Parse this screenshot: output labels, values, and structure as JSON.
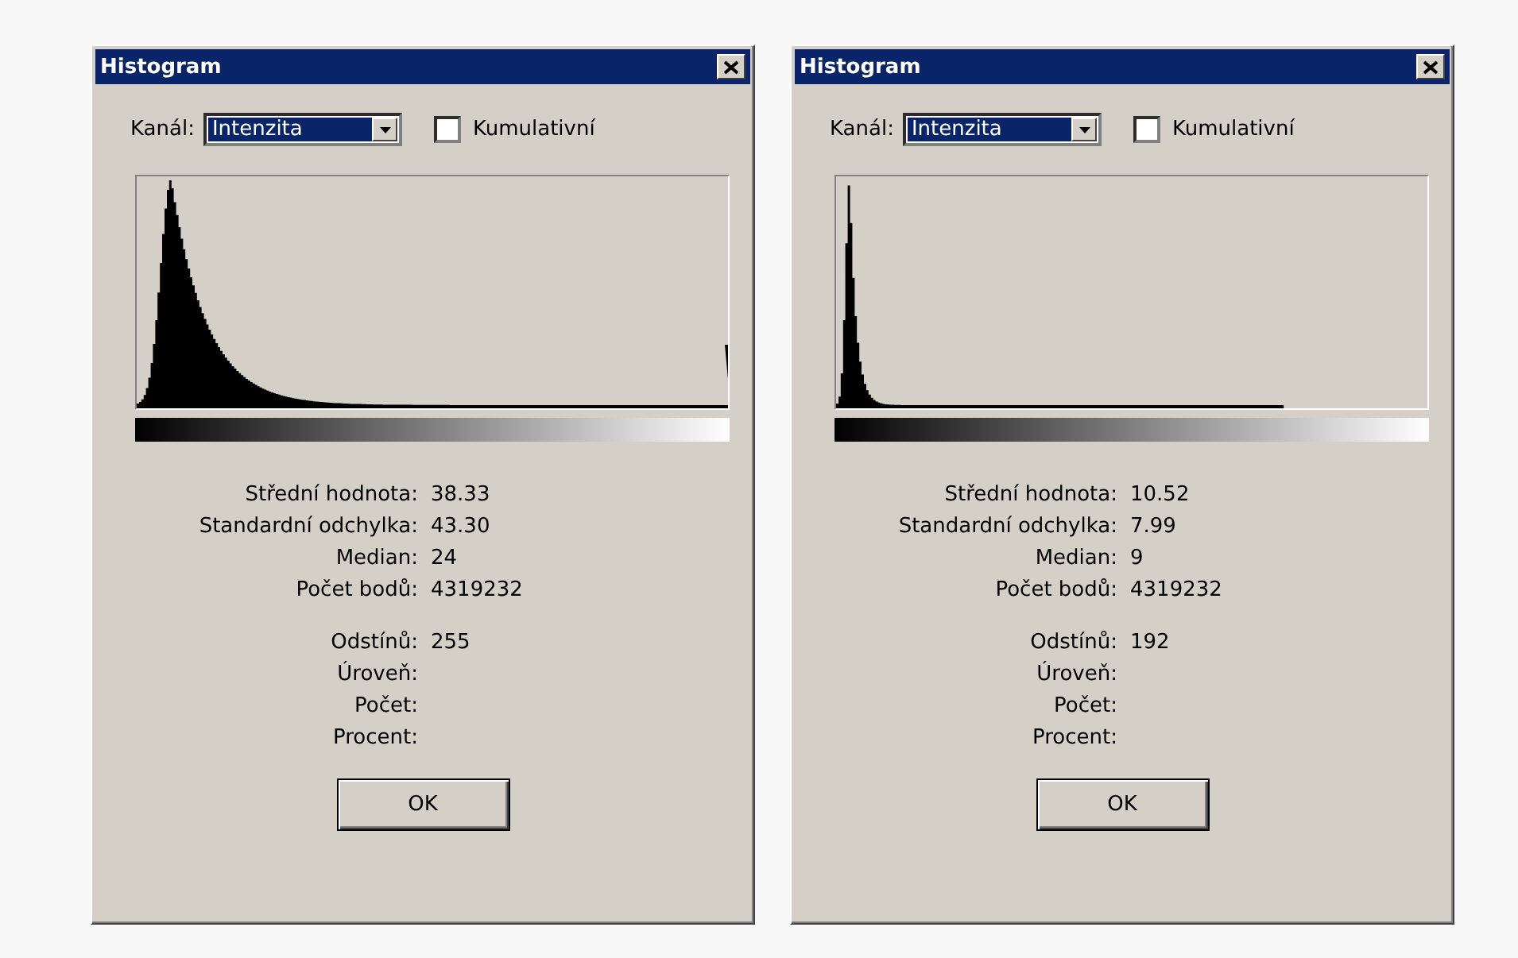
{
  "dialogs": [
    {
      "title": "Histogram",
      "channel_label": "Kanál:",
      "channel_value": "Intenzita",
      "cumulative": {
        "label": "Kumulativní",
        "checked": false
      },
      "stats": [
        {
          "label": "Střední hodnota:",
          "value": "38.33"
        },
        {
          "label": "Standardní odchylka:",
          "value": "43.30"
        },
        {
          "label": "Median:",
          "value": "24"
        },
        {
          "label": "Počet bodů:",
          "value": "4319232"
        }
      ],
      "details": [
        {
          "label": "Odstínů:",
          "value": "255"
        },
        {
          "label": "Úroveň:"
        },
        {
          "label": "Počet:"
        },
        {
          "label": "Procent:"
        }
      ],
      "ok_button": "OK"
    },
    {
      "title": "Histogram",
      "channel_label": "Kanál:",
      "channel_value": "Intenzita",
      "cumulative": {
        "label": "Kumulativní",
        "checked": false
      },
      "stats": [
        {
          "label": "Střední hodnota:",
          "value": "10.52"
        },
        {
          "label": "Standardní odchylka:",
          "value": "7.99"
        },
        {
          "label": "Median:",
          "value": "9"
        },
        {
          "label": "Počet bodů:",
          "value": "4319232"
        }
      ],
      "details": [
        {
          "label": "Odstínů:",
          "value": "192"
        },
        {
          "label": "Úroveň:"
        },
        {
          "label": "Počet:"
        },
        {
          "label": "Procent:"
        }
      ],
      "ok_button": "OK"
    }
  ]
}
